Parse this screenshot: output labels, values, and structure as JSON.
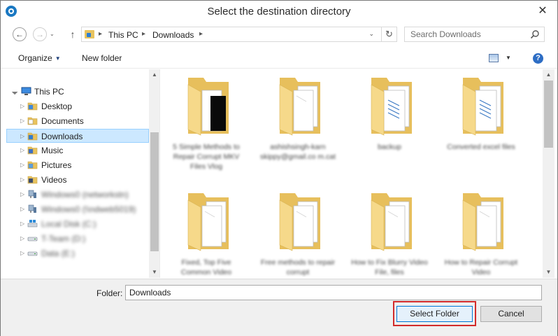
{
  "window": {
    "title": "Select the destination directory",
    "close_glyph": "✕"
  },
  "nav": {
    "back_glyph": "←",
    "forward_glyph": "→",
    "up_glyph": "↑",
    "breadcrumb": [
      "This PC",
      "Downloads"
    ],
    "crumb_separator": "▸",
    "dropdown_glyph": "⌄",
    "refresh_glyph": "↻"
  },
  "search": {
    "placeholder": "Search Downloads"
  },
  "toolbar": {
    "organize_label": "Organize",
    "organize_caret": "▼",
    "new_folder_label": "New folder",
    "view_caret": "▼",
    "help_glyph": "?"
  },
  "tree": {
    "root": "This PC",
    "items": [
      {
        "label": "Desktop",
        "icon": "desktop-folder-icon"
      },
      {
        "label": "Documents",
        "icon": "documents-folder-icon"
      },
      {
        "label": "Downloads",
        "icon": "downloads-folder-icon",
        "selected": true
      },
      {
        "label": "Music",
        "icon": "music-folder-icon"
      },
      {
        "label": "Pictures",
        "icon": "pictures-folder-icon"
      },
      {
        "label": "Videos",
        "icon": "videos-folder-icon"
      },
      {
        "label": "Windows0 (networkstn)",
        "icon": "network-drive-icon",
        "blurred": true
      },
      {
        "label": "Windows0 (\\\\ndweb5019)",
        "icon": "network-drive-icon",
        "blurred": true
      },
      {
        "label": "Local Disk (C:)",
        "icon": "local-disk-icon",
        "blurred": true
      },
      {
        "label": "T-Team (D:)",
        "icon": "drive-icon",
        "blurred": true
      },
      {
        "label": "Data (E:)",
        "icon": "drive-icon",
        "blurred": true
      }
    ]
  },
  "files": [
    {
      "label": "5 Simple Methods to Repair Corrupt MKV Files Vlog",
      "variant": "dark-doc"
    },
    {
      "label": "ashishsingh-karn skippy@gmail.co m.cat",
      "variant": "plain"
    },
    {
      "label": "backup",
      "variant": "lined"
    },
    {
      "label": "Converted excel files",
      "variant": "lined"
    },
    {
      "label": "Fixed, Top Five Common Video",
      "variant": "plain"
    },
    {
      "label": "Free methods to repair corrupt",
      "variant": "plain"
    },
    {
      "label": "How to Fix Blurry Video File, files",
      "variant": "plain"
    },
    {
      "label": "How to Repair Corrupt Video",
      "variant": "plain"
    }
  ],
  "footer": {
    "folder_label": "Folder:",
    "folder_value": "Downloads",
    "select_label": "Select Folder",
    "cancel_label": "Cancel"
  },
  "colors": {
    "selection_bg": "#cce8ff",
    "highlight_border": "#d22b2b",
    "folder_yellow": "#f4d27a"
  }
}
